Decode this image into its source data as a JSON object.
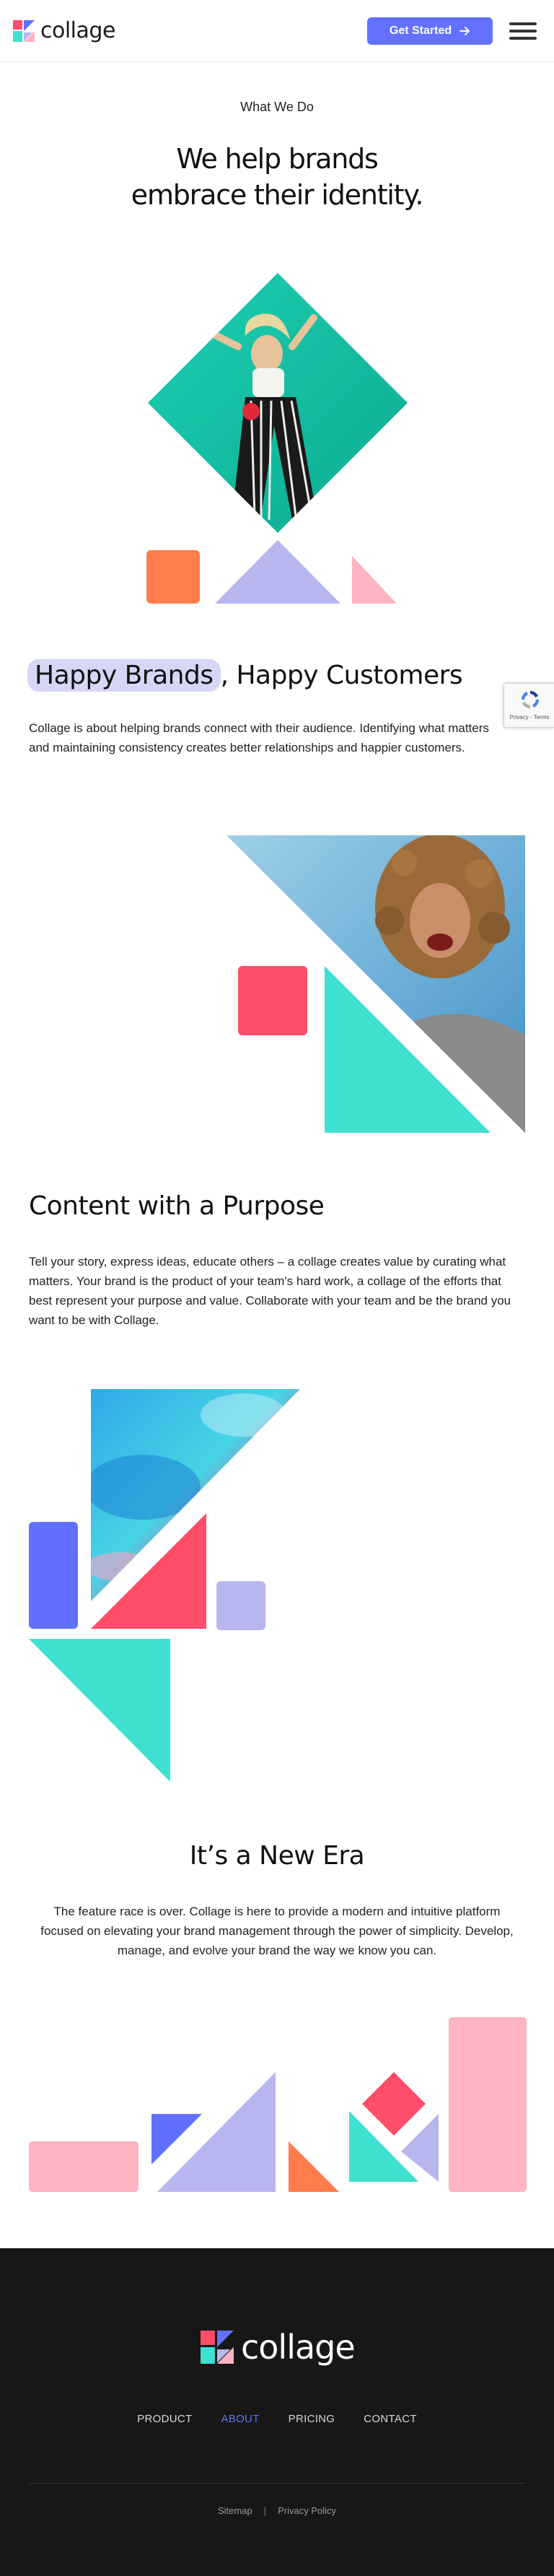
{
  "header": {
    "logo_text": "collage",
    "cta_label": "Get Started",
    "cta_icon": "arrow-right-icon",
    "menu_icon": "hamburger-menu-icon"
  },
  "hero": {
    "eyebrow": "What We Do",
    "title_line1": "We help brands",
    "title_line2": "embrace their identity."
  },
  "happy": {
    "title_highlight": "Happy Brands",
    "title_rest": ", Happy Customers",
    "body": "Collage is about helping brands connect with their audience. Identifying what matters and maintaining consistency creates better relationships and happier customers."
  },
  "recaptcha": {
    "text": "Privacy - Terms"
  },
  "content": {
    "title": "Content with a Purpose",
    "body": "Tell your story, express ideas, educate others – a collage creates value by curating what matters. Your brand is the product of your team's hard work, a collage of the efforts that best represent your purpose and value. Collaborate with your team and be the brand you want to be with Collage."
  },
  "era": {
    "title": "It’s a New Era",
    "body": "The feature race is over. Collage is here to provide a modern and intuitive platform focused on elevating your brand management through the power of simplicity. Develop, manage, and evolve your brand the way we know you can."
  },
  "footer": {
    "logo_text": "collage",
    "nav": [
      "PRODUCT",
      "ABOUT",
      "PRICING",
      "CONTACT"
    ],
    "active_nav": "ABOUT",
    "links": [
      "Sitemap",
      "Privacy Policy"
    ]
  },
  "colors": {
    "accent": "#6470ff",
    "orange": "#ff7c4d",
    "lavender": "#b8b6ef",
    "pink": "#ffb4c1",
    "coral": "#ff4d6a",
    "teal": "#3ee0cf",
    "blue": "#6270ff",
    "footer_bg": "#171717"
  }
}
